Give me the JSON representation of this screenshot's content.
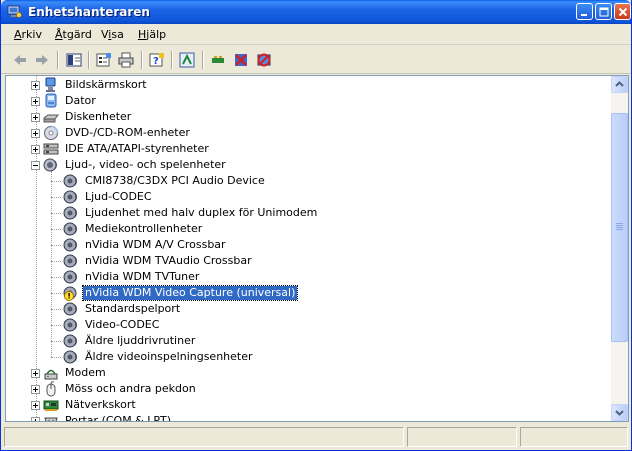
{
  "window": {
    "title": "Enhetshanteraren",
    "accent": "#0a5de8",
    "controls": [
      "minimize-icon",
      "maximize-icon",
      "close-icon"
    ]
  },
  "menu": [
    {
      "pre": "",
      "u": "A",
      "post": "rkiv"
    },
    {
      "pre": "",
      "u": "Å",
      "post": "tgärd"
    },
    {
      "pre": "V",
      "u": "i",
      "post": "sa"
    },
    {
      "pre": "",
      "u": "H",
      "post": "jälp"
    }
  ],
  "toolbar": [
    "back-icon",
    "forward-icon",
    "console-tree-icon",
    "properties-icon",
    "print-icon",
    "help-icon",
    "scan-hardware-icon",
    "update-driver-icon",
    "disable-device-icon",
    "uninstall-device-icon"
  ],
  "tree": {
    "nodes": [
      {
        "label": "Bildskärmskort",
        "icon": "display-adapter-icon",
        "level": 1,
        "expander": "plus"
      },
      {
        "label": "Dator",
        "icon": "computer-icon",
        "level": 1,
        "expander": "plus"
      },
      {
        "label": "Diskenheter",
        "icon": "disk-drive-icon",
        "level": 1,
        "expander": "plus"
      },
      {
        "label": "DVD-/CD-ROM-enheter",
        "icon": "cdrom-icon",
        "level": 1,
        "expander": "plus"
      },
      {
        "label": "IDE ATA/ATAPI-styrenheter",
        "icon": "ide-controller-icon",
        "level": 1,
        "expander": "plus"
      },
      {
        "label": "Ljud-, video- och spelenheter",
        "icon": "sound-icon",
        "level": 1,
        "expander": "minus"
      },
      {
        "label": "CMI8738/C3DX PCI Audio Device",
        "icon": "speaker-icon",
        "level": 2
      },
      {
        "label": "Ljud-CODEC",
        "icon": "speaker-icon",
        "level": 2
      },
      {
        "label": "Ljudenhet med halv duplex för Unimodem",
        "icon": "speaker-icon",
        "level": 2
      },
      {
        "label": "Mediekontrollenheter",
        "icon": "speaker-icon",
        "level": 2
      },
      {
        "label": "nVidia WDM A/V Crossbar",
        "icon": "speaker-icon",
        "level": 2
      },
      {
        "label": "nVidia WDM TVAudio Crossbar",
        "icon": "speaker-icon",
        "level": 2
      },
      {
        "label": "nVidia WDM TVTuner",
        "icon": "speaker-icon",
        "level": 2
      },
      {
        "label": "nVidia WDM Video Capture (universal)",
        "icon": "speaker-warning-icon",
        "level": 2,
        "selected": true
      },
      {
        "label": "Standardspelport",
        "icon": "speaker-icon",
        "level": 2
      },
      {
        "label": "Video-CODEC",
        "icon": "speaker-icon",
        "level": 2
      },
      {
        "label": "Äldre ljuddrivrutiner",
        "icon": "speaker-icon",
        "level": 2
      },
      {
        "label": "Äldre videoinspelningsenheter",
        "icon": "speaker-icon",
        "level": 2
      },
      {
        "label": "Modem",
        "icon": "modem-icon",
        "level": 1,
        "expander": "plus"
      },
      {
        "label": "Möss och andra pekdon",
        "icon": "mouse-icon",
        "level": 1,
        "expander": "plus"
      },
      {
        "label": "Nätverkskort",
        "icon": "network-card-icon",
        "level": 1,
        "expander": "plus"
      },
      {
        "label": "Portar (COM & LPT)",
        "icon": "port-icon",
        "level": 1,
        "expander": "plus"
      }
    ],
    "selection_color": "#316ac5"
  }
}
